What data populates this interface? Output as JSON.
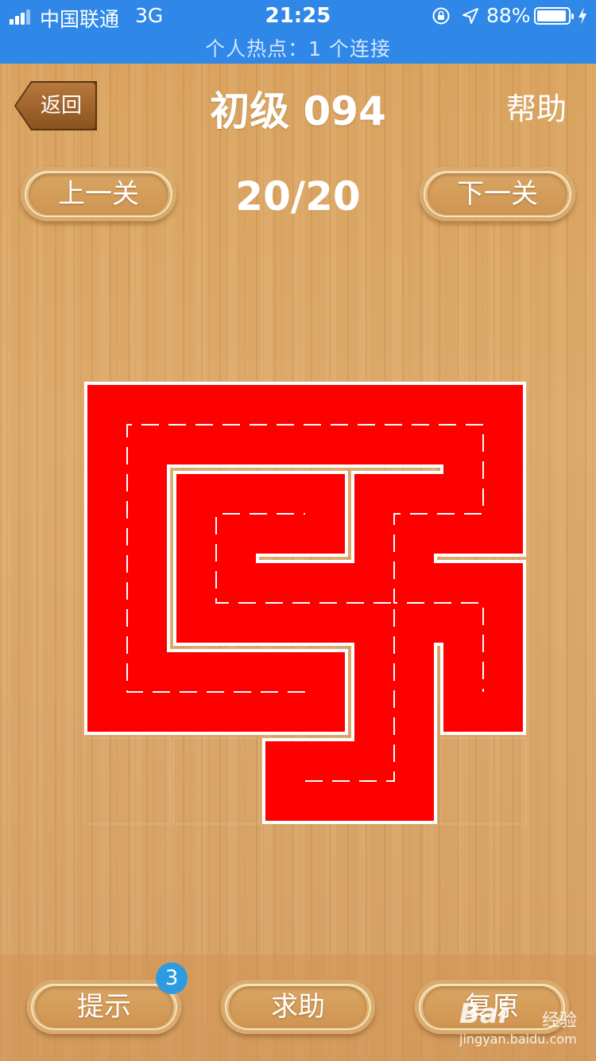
{
  "status_bar": {
    "carrier": "中国联通",
    "network": "3G",
    "time": "21:25",
    "battery": "88%",
    "hotspot": "个人热点：1 个连接"
  },
  "header": {
    "back_label": "返回",
    "title": "初级 094",
    "help_label": "帮助"
  },
  "nav": {
    "prev_label": "上一关",
    "progress": "20/20",
    "next_label": "下一关"
  },
  "board": {
    "rows": 5,
    "cols": 5,
    "path_color": "#ff0000",
    "paths": [
      [
        [
          2,
          3
        ],
        [
          1,
          3
        ],
        [
          0,
          3
        ],
        [
          0,
          2
        ],
        [
          0,
          1
        ],
        [
          0,
          0
        ],
        [
          1,
          0
        ],
        [
          2,
          0
        ],
        [
          3,
          0
        ],
        [
          4,
          0
        ],
        [
          4,
          1
        ],
        [
          3,
          1
        ],
        [
          3,
          2
        ],
        [
          4,
          2
        ],
        [
          4,
          3
        ]
      ],
      [
        [
          2,
          4
        ],
        [
          3,
          4
        ],
        [
          3,
          3
        ],
        [
          3,
          2
        ],
        [
          2,
          2
        ],
        [
          1,
          2
        ],
        [
          1,
          1
        ],
        [
          2,
          1
        ]
      ]
    ]
  },
  "bottom": {
    "hint_label": "提示",
    "hint_count": "3",
    "help_label": "求助",
    "reset_label": "复原"
  },
  "watermark": {
    "brand": "Bai",
    "sub": "经验",
    "url": "jingyan.baidu.com"
  },
  "colors": {
    "statusbar": "#2f88e8",
    "path": "#ff0000",
    "badge": "#2d9be0"
  }
}
